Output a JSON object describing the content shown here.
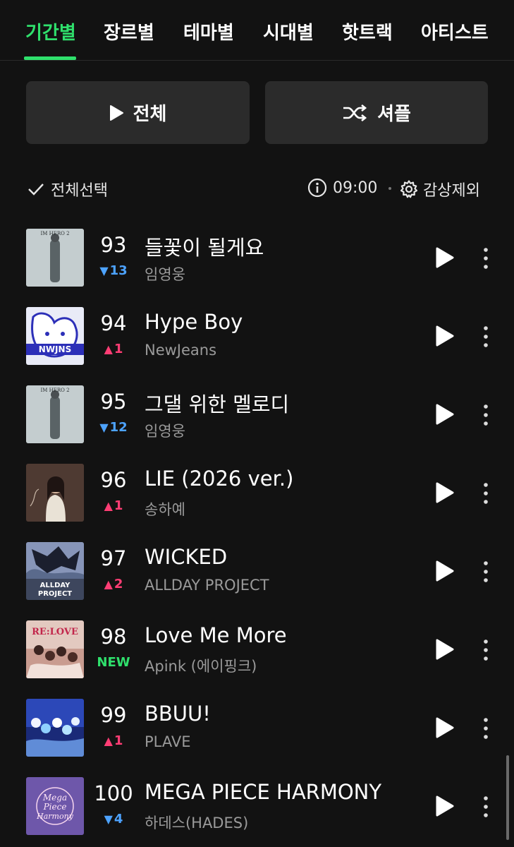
{
  "tabs": [
    {
      "label": "기간별",
      "active": true
    },
    {
      "label": "장르별"
    },
    {
      "label": "테마별"
    },
    {
      "label": "시대별"
    },
    {
      "label": "핫트랙"
    },
    {
      "label": "아티스트"
    }
  ],
  "actions": {
    "play_all_label": "전체",
    "shuffle_label": "셔플"
  },
  "toolbar": {
    "select_all_label": "전체선택",
    "duration": "09:00",
    "exclude_label": "감상제외"
  },
  "colors": {
    "accent": "#2fe06c",
    "rank_up": "#ff3d74",
    "rank_down": "#4da3ff",
    "background": "#121212",
    "button_bg": "#2b2b2b"
  },
  "songs": [
    {
      "rank": "93",
      "change_dir": "down",
      "change": "13",
      "title": "들꽃이 될게요",
      "artist": "임영웅",
      "art_icon": "album-im-hero-2"
    },
    {
      "rank": "94",
      "change_dir": "up",
      "change": "1",
      "title": "Hype Boy",
      "artist": "NewJeans",
      "art_icon": "album-newjeans"
    },
    {
      "rank": "95",
      "change_dir": "down",
      "change": "12",
      "title": "그댈 위한 멜로디",
      "artist": "임영웅",
      "art_icon": "album-im-hero-2"
    },
    {
      "rank": "96",
      "change_dir": "up",
      "change": "1",
      "title": "LIE (2026 ver.)",
      "artist": "송하예",
      "art_icon": "album-portrait"
    },
    {
      "rank": "97",
      "change_dir": "up",
      "change": "2",
      "title": "WICKED",
      "artist": "ALLDAY PROJECT",
      "art_icon": "album-allday-project"
    },
    {
      "rank": "98",
      "change_dir": "new",
      "change": "NEW",
      "title": "Love Me More",
      "artist": "Apink (에이핑크)",
      "art_icon": "album-re-love"
    },
    {
      "rank": "99",
      "change_dir": "up",
      "change": "1",
      "title": "BBUU!",
      "artist": "PLAVE",
      "art_icon": "album-plave"
    },
    {
      "rank": "100",
      "change_dir": "down",
      "change": "4",
      "title": "MEGA PIECE HARMONY",
      "artist": "하데스(HADES)",
      "art_icon": "album-mega-piece-harmony"
    }
  ],
  "album_art_text": {
    "im_hero": "IM HERO 2",
    "newjeans": "NWJNS",
    "allday": "ALLDAY PROJECT",
    "relove": "RE:LOVE",
    "mega": "Mega Piece Harmony"
  }
}
